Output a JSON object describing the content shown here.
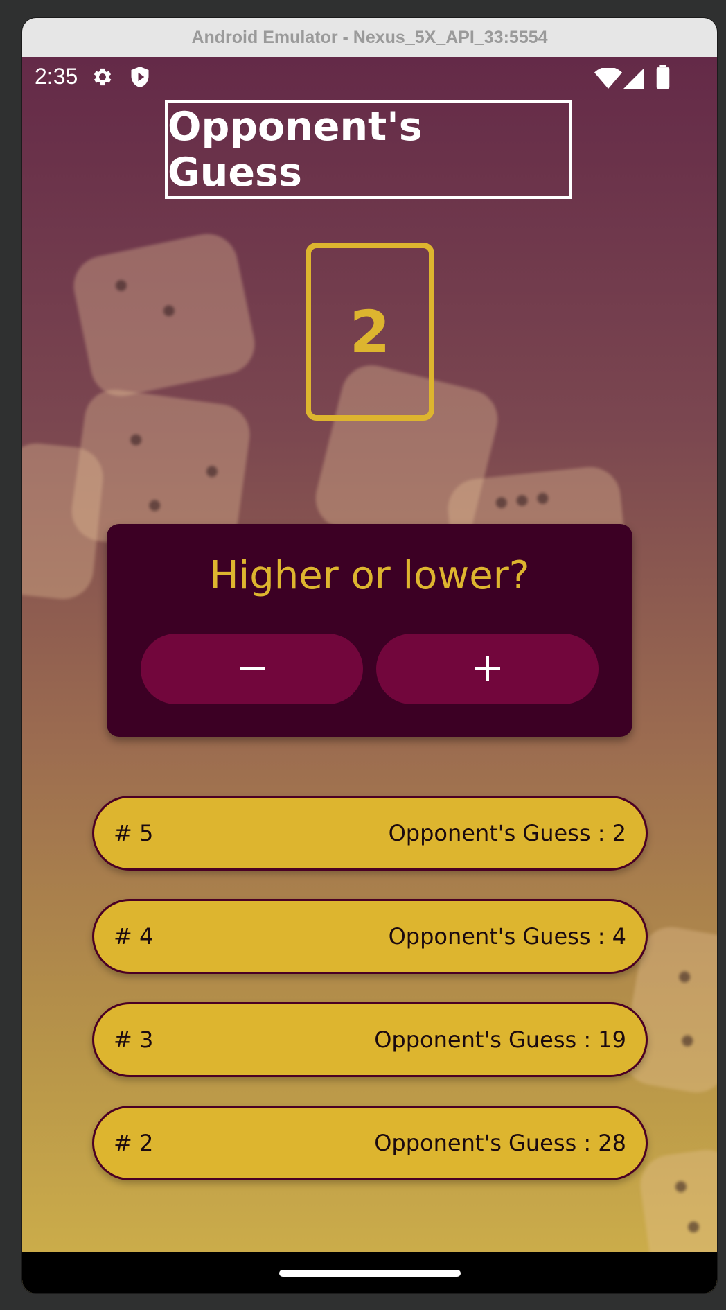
{
  "window": {
    "title": "Android Emulator - Nexus_5X_API_33:5554"
  },
  "status_bar": {
    "time": "2:35",
    "left_icons": [
      "settings-gear-icon",
      "shield-icon"
    ],
    "right_icons": [
      "wifi-icon",
      "signal-icon",
      "battery-icon"
    ]
  },
  "screen": {
    "title": "Opponent's Guess",
    "current_guess": "2",
    "prompt": "Higher or lower?",
    "buttons": {
      "minus_icon": "minus-icon",
      "plus_icon": "plus-icon"
    },
    "guess_log": [
      {
        "round": "# 5",
        "text": "Opponent's Guess : 2"
      },
      {
        "round": "# 4",
        "text": "Opponent's Guess : 4"
      },
      {
        "round": "# 3",
        "text": "Opponent's Guess : 19"
      },
      {
        "round": "# 2",
        "text": "Opponent's Guess : 28"
      }
    ]
  },
  "colors": {
    "accent": "#ddb52f",
    "card_bg": "#3c0024",
    "button_bg": "#72063c",
    "gradient_top": "#642a48",
    "gradient_bottom": "#cfb14a"
  }
}
